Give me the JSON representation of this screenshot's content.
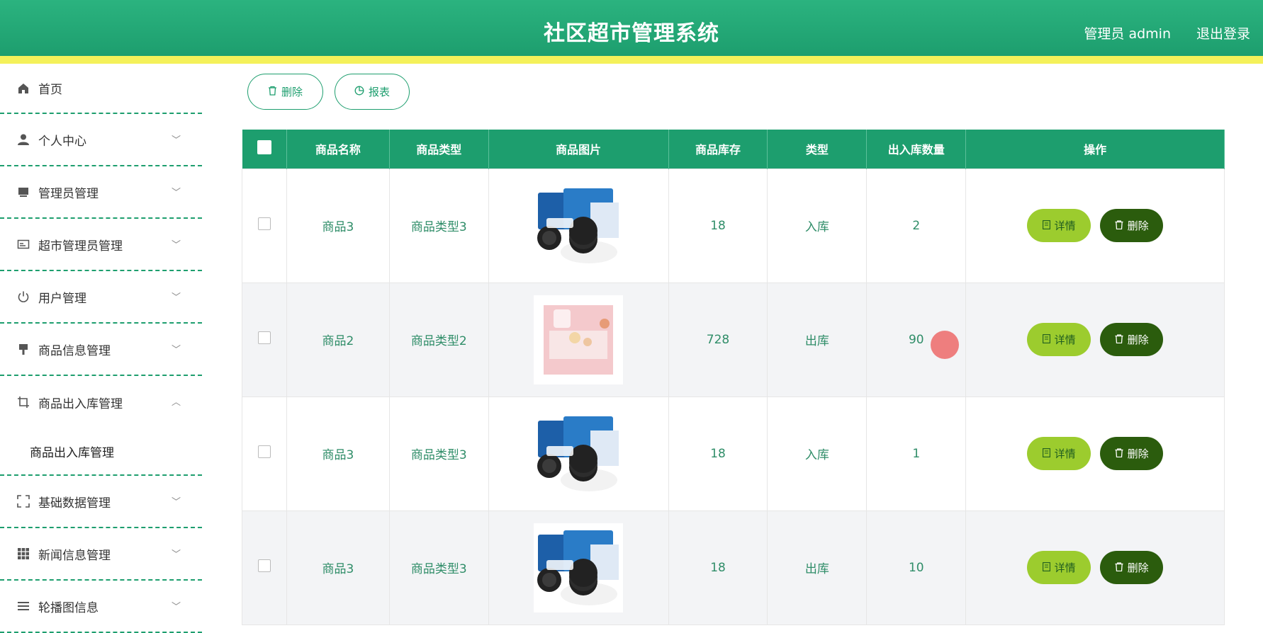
{
  "header": {
    "title": "社区超市管理系统",
    "user": "管理员 admin",
    "logout": "退出登录"
  },
  "sidebar": {
    "items": [
      {
        "label": "首页",
        "icon": "home-icon"
      },
      {
        "label": "个人中心",
        "icon": "user-icon"
      },
      {
        "label": "管理员管理",
        "icon": "monitor-icon"
      },
      {
        "label": "超市管理员管理",
        "icon": "id-card-icon"
      },
      {
        "label": "用户管理",
        "icon": "power-icon"
      },
      {
        "label": "商品信息管理",
        "icon": "brush-icon"
      },
      {
        "label": "商品出入库管理",
        "icon": "crop-icon"
      },
      {
        "label": "基础数据管理",
        "icon": "full-screen-icon"
      },
      {
        "label": "新闻信息管理",
        "icon": "grid-icon"
      },
      {
        "label": "轮播图信息",
        "icon": "list-icon"
      }
    ],
    "submenu_active": "商品出入库管理"
  },
  "toolbar": {
    "delete_label": "删除",
    "report_label": "报表"
  },
  "table": {
    "headers": [
      "商品名称",
      "商品类型",
      "商品图片",
      "商品库存",
      "类型",
      "出入库数量",
      "操作"
    ],
    "rows": [
      {
        "name": "商品3",
        "type": "商品类型3",
        "image": "oreo-pack",
        "stock": "18",
        "io_type": "入库",
        "qty": "2"
      },
      {
        "name": "商品2",
        "type": "商品类型2",
        "image": "pink-snack",
        "stock": "728",
        "io_type": "出库",
        "qty": "90"
      },
      {
        "name": "商品3",
        "type": "商品类型3",
        "image": "oreo-pack",
        "stock": "18",
        "io_type": "入库",
        "qty": "1"
      },
      {
        "name": "商品3",
        "type": "商品类型3",
        "image": "oreo-pack",
        "stock": "18",
        "io_type": "出库",
        "qty": "10"
      }
    ],
    "detail_label": "详情",
    "delete_label": "删除"
  },
  "colors": {
    "primary": "#1d9e6e",
    "accent_bar": "#f4f15a",
    "detail_btn": "#9ccc2e",
    "delete_btn": "#2b5c0d"
  }
}
